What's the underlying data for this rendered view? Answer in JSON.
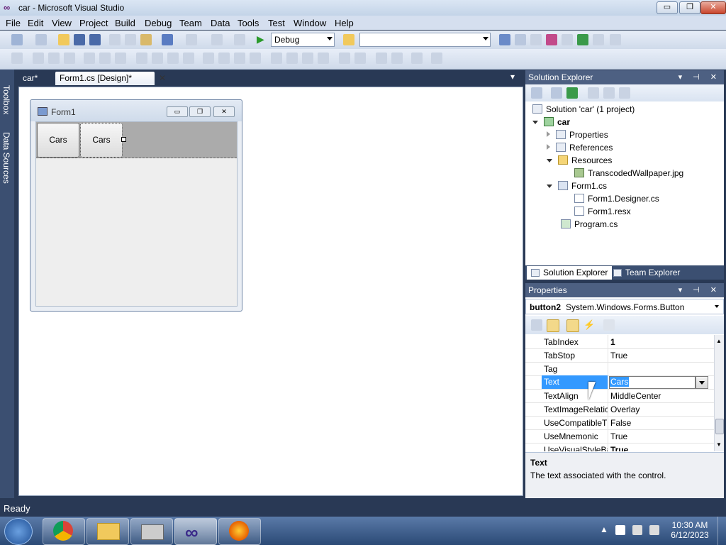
{
  "window": {
    "title": "car - Microsoft Visual Studio",
    "minimize": "▭",
    "restore": "❐",
    "close": "✕"
  },
  "menu": [
    "File",
    "Edit",
    "View",
    "Project",
    "Build",
    "Debug",
    "Team",
    "Data",
    "Tools",
    "Test",
    "Window",
    "Help"
  ],
  "toolbar": {
    "config": "Debug",
    "platform": ""
  },
  "leftstrip": {
    "toolbox": "Toolbox",
    "datasources": "Data Sources"
  },
  "doctabs": {
    "tab1": "car*",
    "tab2": "Form1.cs [Design]*",
    "close": "✕",
    "dropdown": "▾"
  },
  "form": {
    "title": "Form1",
    "button1": "Cars",
    "button2": "Cars"
  },
  "solution_explorer": {
    "title": "Solution Explorer",
    "items": [
      {
        "label": "Solution 'car' (1 project)"
      },
      {
        "label": "car"
      },
      {
        "label": "Properties"
      },
      {
        "label": "References"
      },
      {
        "label": "Resources"
      },
      {
        "label": "TranscodedWallpaper.jpg"
      },
      {
        "label": "Form1.cs"
      },
      {
        "label": "Form1.Designer.cs"
      },
      {
        "label": "Form1.resx"
      },
      {
        "label": "Program.cs"
      }
    ],
    "tab_solution": "Solution Explorer",
    "tab_team": "Team Explorer"
  },
  "properties": {
    "title": "Properties",
    "object_name": "button2",
    "object_type": "System.Windows.Forms.Button",
    "rows": [
      {
        "name": "TabIndex",
        "value": "1"
      },
      {
        "name": "TabStop",
        "value": "True"
      },
      {
        "name": "Tag",
        "value": ""
      },
      {
        "name": "Text",
        "value": "Cars"
      },
      {
        "name": "TextAlign",
        "value": "MiddleCenter"
      },
      {
        "name": "TextImageRelatic",
        "value": "Overlay"
      },
      {
        "name": "UseCompatibleT",
        "value": "False"
      },
      {
        "name": "UseMnemonic",
        "value": "True"
      },
      {
        "name": "UseVisualStyleBa",
        "value": "True"
      }
    ],
    "desc_title": "Text",
    "desc_text": "The text associated with the control."
  },
  "status": {
    "text": "Ready"
  },
  "taskbar": {
    "time": "10:30 AM",
    "date": "6/12/2023"
  }
}
